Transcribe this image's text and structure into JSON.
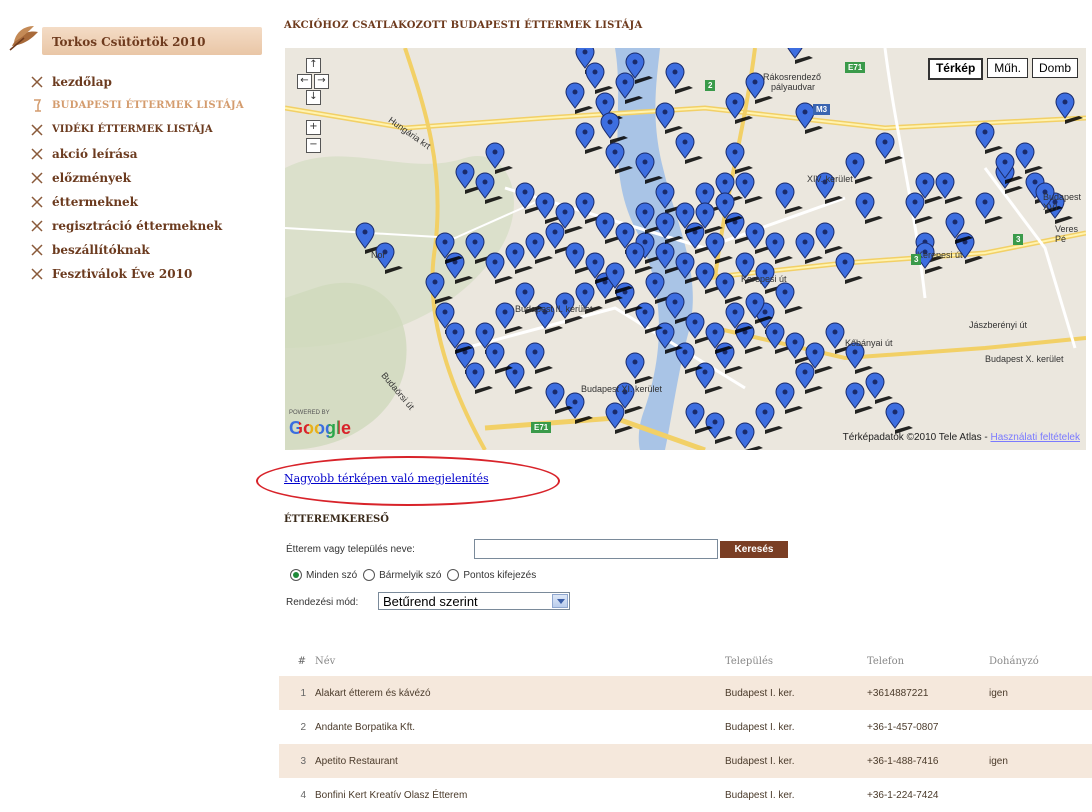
{
  "sidebar": {
    "header_title": "Torkos Csütörtök 2010",
    "items": [
      {
        "label": "kezdőlap"
      },
      {
        "label": "BUDAPESTI ÉTTERMEK LISTÁJA"
      },
      {
        "label": "VIDÉKI ÉTTERMEK LISTÁJA"
      },
      {
        "label": "akció leírása"
      },
      {
        "label": "előzmények"
      },
      {
        "label": "éttermeknek"
      },
      {
        "label": "regisztráció éttermeknek"
      },
      {
        "label": "beszállítóknak"
      },
      {
        "label": "Fesztiválok Éve 2010"
      }
    ]
  },
  "main": {
    "page_title": "AKCIÓHOZ CSATLAKOZOTT BUDAPESTI ÉTTERMEK LISTÁJA",
    "map": {
      "type_buttons": [
        "Térkép",
        "Műh.",
        "Domb"
      ],
      "selected_type": "Térkép",
      "powered_by": "POWERED BY",
      "logo_text": "Google",
      "attribution": "Térképadatok ©2010 Tele Atlas -",
      "terms_link": "Használati feltételek",
      "labels": [
        "Rákosrendező",
        "pályaudvar",
        "XIV. kerület",
        "Budapest XVI",
        "Kerepesi út",
        "Jászberényi út",
        "Kőbányai út",
        "Budapest X. kerület",
        "Budapest XI. kerület",
        "Budapest II. kerület",
        "Nor",
        "Budaörsi út",
        "Hungária krt",
        "Kerepesi út",
        "Veres Pé"
      ],
      "shields": [
        "E71",
        "2",
        "M3",
        "3",
        "3",
        "E71"
      ]
    },
    "bigger_map_link": "Nagyobb térképen való megjelenítés",
    "search": {
      "title": "ÉTTEREMKERESŐ",
      "label": "Étterem vagy település neve:",
      "input_value": "",
      "button": "Keresés",
      "radios": [
        {
          "label": "Minden szó",
          "checked": true
        },
        {
          "label": "Bármelyik szó",
          "checked": false
        },
        {
          "label": "Pontos kifejezés",
          "checked": false
        }
      ],
      "sort_label": "Rendezési mód:",
      "sort_value": "Betűrend szerint"
    },
    "table": {
      "headers": [
        "#",
        "Név",
        "Település",
        "Telefon",
        "Dohányzó"
      ],
      "rows": [
        {
          "num": "1",
          "name": "Alakart étterem és kávézó",
          "city": "Budapest I. ker.",
          "phone": "+3614887221",
          "smoking": "igen"
        },
        {
          "num": "2",
          "name": "Andante Borpatika Kft.",
          "city": "Budapest I. ker.",
          "phone": "+36-1-457-0807",
          "smoking": ""
        },
        {
          "num": "3",
          "name": "Apetito Restaurant",
          "city": "Budapest I. ker.",
          "phone": "+36-1-488-7416",
          "smoking": "igen"
        },
        {
          "num": "4",
          "name": "Bonfini Kert Kreatív Olasz Étterem",
          "city": "Budapest I. ker.",
          "phone": "+36-1-224-7424",
          "smoking": ""
        }
      ]
    }
  },
  "colors": {
    "accent_brown": "#6e3a1d",
    "active_nav": "#d49c6e",
    "row_highlight": "#f5e8dc",
    "search_button": "#7a3e24",
    "marker_blue": "#3d6ee0",
    "annotation_circle": "#d8232a"
  }
}
